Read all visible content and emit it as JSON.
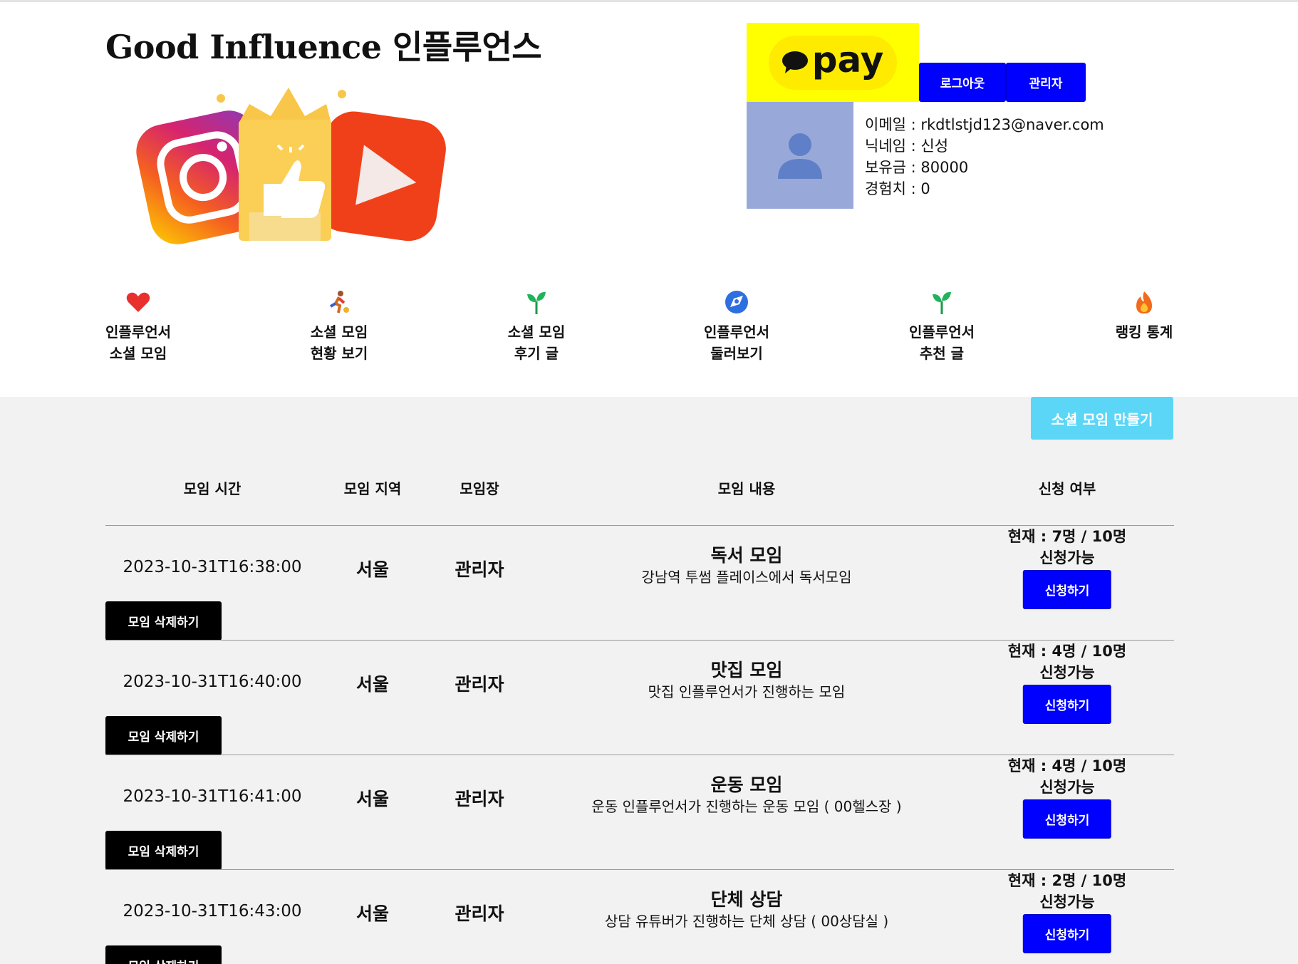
{
  "header": {
    "site_title": "Good Influence 인플루언스",
    "pay_label": "pay",
    "logout_label": "로그아웃",
    "admin_label": "관리자"
  },
  "profile": {
    "email": "이메일 : rkdtlstjd123@naver.com",
    "nickname": "닉네임 : 신성",
    "balance": "보유금 : 80000",
    "experience": "경험치 : 0"
  },
  "nav": {
    "items": [
      {
        "line1": "인플루언서",
        "line2": "소셜 모임",
        "icon": "heart-icon"
      },
      {
        "line1": "소셜 모임",
        "line2": "현황 보기",
        "icon": "runner-icon"
      },
      {
        "line1": "소셜 모임",
        "line2": "후기 글",
        "icon": "sprout-icon"
      },
      {
        "line1": "인플루언서",
        "line2": "둘러보기",
        "icon": "compass-icon"
      },
      {
        "line1": "인플루언서",
        "line2": "추천 글",
        "icon": "sprout-icon"
      },
      {
        "line1": "랭킹 통계",
        "line2": "",
        "icon": "fire-icon"
      }
    ]
  },
  "actions": {
    "create_label": "소셜 모임 만들기"
  },
  "table": {
    "headers": {
      "time": "모임 시간",
      "region": "모임 지역",
      "host": "모임장",
      "content": "모임 내용",
      "status": "신청 여부"
    },
    "rows": [
      {
        "time": "2023-10-31T16:38:00",
        "region": "서울",
        "host": "관리자",
        "title": "독서 모임",
        "desc": "강남역 투썸 플레이스에서 독서모임",
        "count": "현재 : 7명 / 10명",
        "avail": "신청가능",
        "apply": "신청하기",
        "delete": "모임 삭제하기"
      },
      {
        "time": "2023-10-31T16:40:00",
        "region": "서울",
        "host": "관리자",
        "title": "맛집 모임",
        "desc": "맛집 인플루언서가 진행하는 모임",
        "count": "현재 : 4명 / 10명",
        "avail": "신청가능",
        "apply": "신청하기",
        "delete": "모임 삭제하기"
      },
      {
        "time": "2023-10-31T16:41:00",
        "region": "서울",
        "host": "관리자",
        "title": "운동 모임",
        "desc": "운동 인플루언서가 진행하는 운동 모임 ( 00헬스장 )",
        "count": "현재 : 4명 / 10명",
        "avail": "신청가능",
        "apply": "신청하기",
        "delete": "모임 삭제하기"
      },
      {
        "time": "2023-10-31T16:43:00",
        "region": "서울",
        "host": "관리자",
        "title": "단체 상담",
        "desc": "상담 유튜버가 진행하는 단체 상담 ( 00상담실 )",
        "count": "현재 : 2명 / 10명",
        "avail": "신청가능",
        "apply": "신청하기",
        "delete": "모임 삭제하기"
      }
    ]
  },
  "colors": {
    "primary_button": "#0000ff",
    "create_button": "#5bd6f7",
    "pay_yellow": "#ffff00",
    "avatar_bg": "#98a9d9",
    "content_bg": "#f2f2f2"
  }
}
